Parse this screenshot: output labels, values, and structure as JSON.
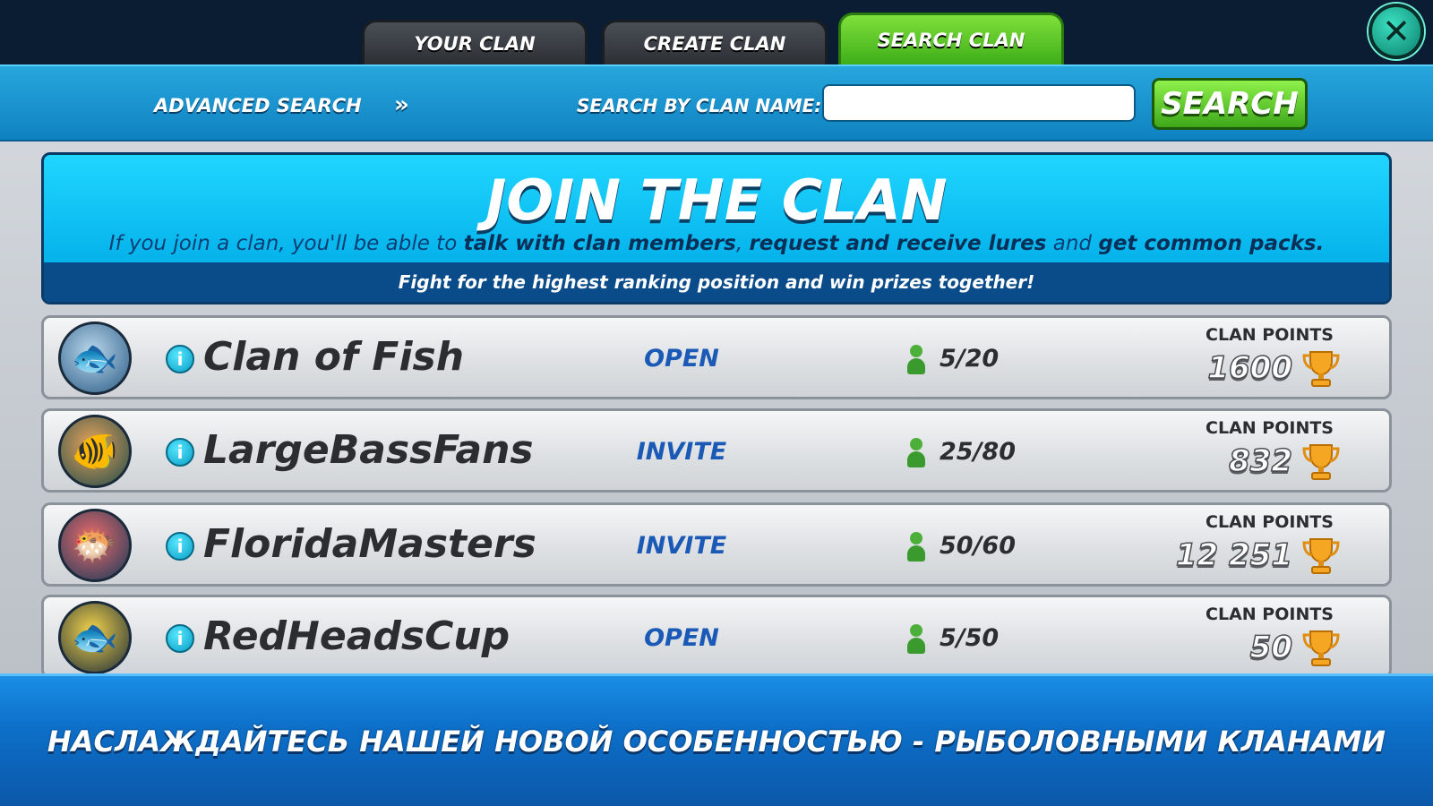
{
  "tabs": {
    "your_clan": "YOUR CLAN",
    "create_clan": "CREATE CLAN",
    "search_clan": "SEARCH CLAN"
  },
  "close_icon": "close-icon",
  "search": {
    "advanced_label": "ADVANCED SEARCH",
    "advanced_arrow": "»",
    "name_label": "SEARCH BY CLAN NAME:",
    "input_value": "",
    "button_label": "SEARCH"
  },
  "banner": {
    "title": "JOIN THE CLAN",
    "desc_part1": "If you join a clan, you'll be able to ",
    "desc_bold1": "talk with clan members",
    "desc_part2": ", ",
    "desc_bold2": "request and receive lures",
    "desc_part3": " and ",
    "desc_bold3": "get common packs.",
    "footer": "Fight for the highest ranking position and win prizes together!"
  },
  "points_label": "CLAN POINTS",
  "clans": [
    {
      "name": "Clan of Fish",
      "status": "OPEN",
      "members": "5/20",
      "points": "1600"
    },
    {
      "name": "LargeBassFans",
      "status": "INVITE",
      "members": "25/80",
      "points": "832"
    },
    {
      "name": "FloridaMasters",
      "status": "INVITE",
      "members": "50/60",
      "points": "12 251"
    },
    {
      "name": "RedHeadsCup",
      "status": "OPEN",
      "members": "5/50",
      "points": "50"
    }
  ],
  "promo": "НАСЛАЖДАЙТЕСЬ НАШЕЙ НОВОЙ ОСОБЕННОСТЬЮ - РЫБОЛОВНЫМИ КЛАНАМИ",
  "colors": {
    "accent_green": "#3fae1a",
    "accent_blue": "#0f82c1",
    "status_blue": "#1a59b5"
  }
}
